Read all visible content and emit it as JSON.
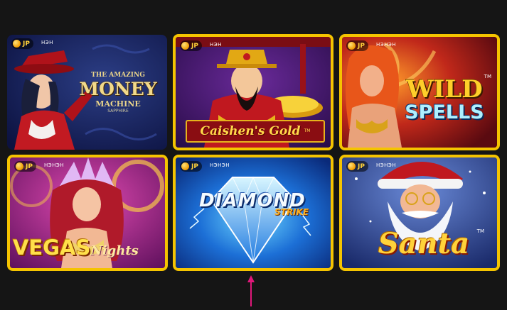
{
  "badge": {
    "label": "JP",
    "icon": "jackpot-coin-icon"
  },
  "games": [
    {
      "id": "money-machine",
      "status": "НЭН",
      "title_top": "THE AMAZING",
      "title_main": "MONEY",
      "title_sub": "MACHINE",
      "title_tag": "SAPPHIRE"
    },
    {
      "id": "caishens-gold",
      "status": "НЭН",
      "title_main": "Caishen's Gold",
      "tm": "TM"
    },
    {
      "id": "wild-spells",
      "status": "НЭНЭН",
      "title_main": "WILD",
      "title_sub": "SPELLS",
      "tm": "TM"
    },
    {
      "id": "vegas-nights",
      "status": "НЭНЭН",
      "title_main": "VEGAS",
      "title_sub": "Nights"
    },
    {
      "id": "diamond-strike",
      "status": "НЭНЭН",
      "title_main": "DIAMOND",
      "title_sub": "STRIKE"
    },
    {
      "id": "santa",
      "status": "НЭНЭН",
      "title_main": "Santa",
      "tm": "TM"
    }
  ],
  "colors": {
    "frame_gold": "#f5c400",
    "background": "#151515",
    "pointer": "#e0177a"
  }
}
